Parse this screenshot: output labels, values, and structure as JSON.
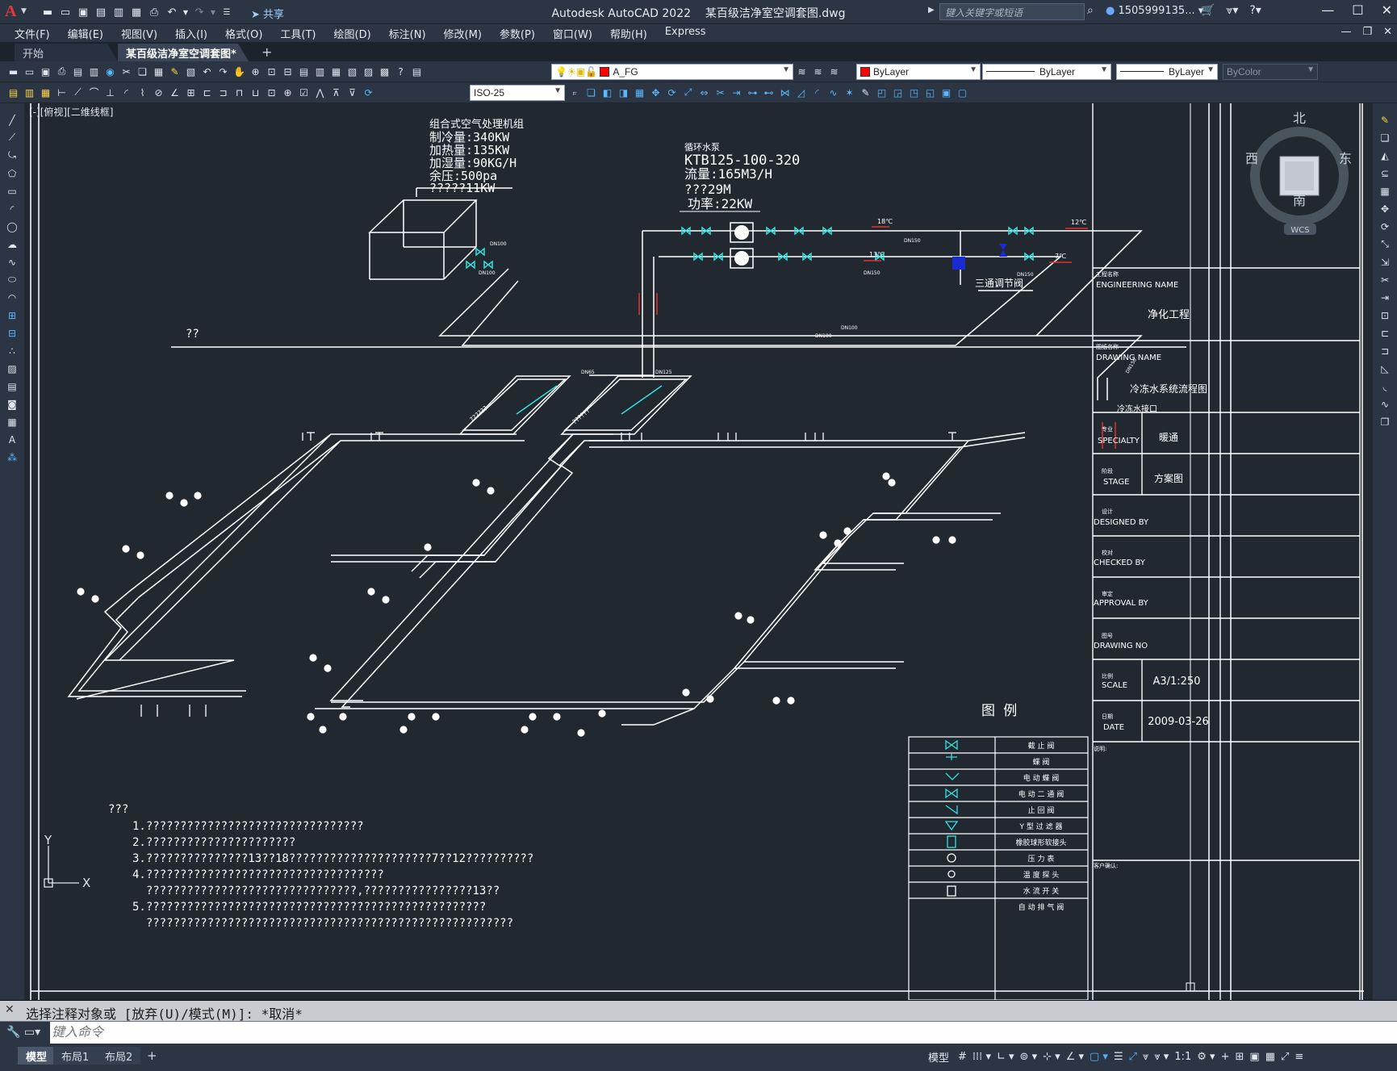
{
  "titlebar": {
    "app_title": "Autodesk AutoCAD 2022",
    "file_title": "某百级洁净室空调套图.dwg",
    "share_label": "共享",
    "search_placeholder": "键入关键字或短语",
    "user_name": "1505999135...",
    "window_controls": [
      "—",
      "☐",
      "✕"
    ]
  },
  "menu": {
    "items": [
      "文件(F)",
      "编辑(E)",
      "视图(V)",
      "插入(I)",
      "格式(O)",
      "工具(T)",
      "绘图(D)",
      "标注(N)",
      "修改(M)",
      "参数(P)",
      "窗口(W)",
      "帮助(H)",
      "Express"
    ]
  },
  "tabs": {
    "start": "开始",
    "drawing": "某百级洁净室空调套图*",
    "add": "+"
  },
  "toolbar": {
    "layer_name": "A_FG",
    "layer_color": "#ff0000",
    "color_value": "ByLayer",
    "linetype_value": "ByLayer",
    "lineweight_value": "ByLayer",
    "plotstyle_value": "ByColor",
    "dimstyle_value": "ISO-25"
  },
  "viewport": {
    "label": "[-][俯视][二维线框]"
  },
  "viewcube": {
    "north": "北",
    "south": "南",
    "west": "西",
    "east": "东",
    "wcs": "WCS"
  },
  "drawing": {
    "ahu_title": "组合式空气处理机组",
    "ahu_lines": [
      "制冷量:340KW",
      "加热量:135KW",
      "加湿量:90KG/H",
      "余压:500pa",
      "?????11KW"
    ],
    "pump_title": "循环水泵",
    "pump_lines": [
      "KTB125-100-320",
      "流量:165M3/H",
      "???29M",
      "功率:22KW"
    ],
    "three_way_valve": "三通调节阀",
    "chilled_water_interface": "冷冻水接口",
    "roof_label": "??",
    "temps": [
      "18℃",
      "12℃",
      "13℃",
      "7℃"
    ],
    "pipe_sizes": [
      "DN150",
      "DN150",
      "DN150",
      "DN100",
      "DN100",
      "DN65",
      "DN125",
      "DN100",
      "DN100",
      "DN150"
    ],
    "manifold_labels": [
      "??????",
      "??????"
    ],
    "legend_title": "图  例",
    "legend_items": [
      "截 止 阀",
      "蝶   阀",
      "电 动 蝶 阀",
      "电 动 二 通 阀",
      "止 回 阀",
      "Y 型 过 滤 器",
      "橡胶球形软接头",
      "压 力 表",
      "温 度 探 头",
      "水 流 开 关",
      "自 动 排 气 阀"
    ],
    "notes_title": "???",
    "notes": [
      "1.????????????????????????????????",
      "2.??????????????????????",
      "3.???????????????13??18?????????????????????7??12??????????",
      "4.???????????????????????????????????",
      "  ???????????????????????????????,????????????????13??",
      "5.??????????????????????????????????????????????????",
      "  ??????????????????????????????????????????????????????"
    ]
  },
  "titleblock": {
    "engineering_cn": "工程名称",
    "engineering_en": "ENGINEERING NAME",
    "engineering_value": "净化工程",
    "drawing_cn": "图纸名称",
    "drawing_en": "DRAWING NAME",
    "drawing_value": "冷冻水系统流程图",
    "specialty_cn": "专业",
    "specialty_en": "SPECIALTY",
    "specialty_value": "暖通",
    "stage_cn": "阶段",
    "stage_en": "STAGE",
    "stage_value": "方案图",
    "designed_cn": "设计",
    "designed_en": "DESIGNED BY",
    "checked_cn": "校对",
    "checked_en": "CHECKED BY",
    "approval_cn": "审定",
    "approval_en": "APPROVAL BY",
    "drawing_no_cn": "图号",
    "drawing_no_en": "DRAWING NO",
    "scale_cn": "比例",
    "scale_en": "SCALE",
    "scale_value": "A3/1:250",
    "date_cn": "日期",
    "date_en": "DATE",
    "date_value": "2009-03-26",
    "remark_cn": "说明:",
    "client_cn": "客户确认:"
  },
  "ucs": {
    "y": "Y",
    "x": "X"
  },
  "command": {
    "history": "选择注释对象或 [放弃(U)/模式(M)]: *取消*",
    "placeholder": "键入命令"
  },
  "status": {
    "layout_tabs": [
      "模型",
      "布局1",
      "布局2"
    ],
    "add_tab": "+",
    "model_label": "模型",
    "scale_label": "1:1"
  }
}
